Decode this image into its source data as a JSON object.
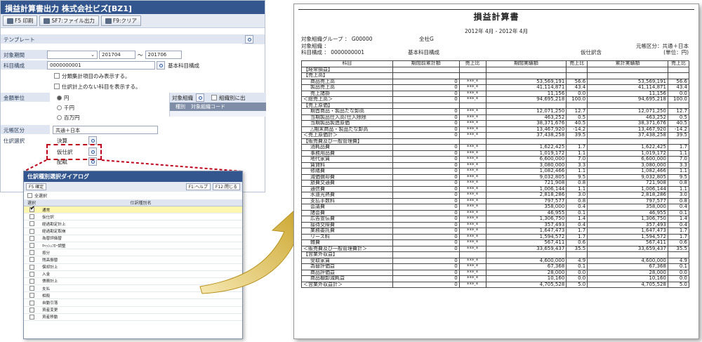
{
  "app": {
    "title": "損益計算書出力 株式会社ビズ[BZ1]",
    "toolbar": [
      {
        "label": "F5 印刷"
      },
      {
        "label": "SF7:ファイル出力"
      },
      {
        "label": "F9:クリア"
      }
    ],
    "template_label": "テンプレート",
    "period_label": "対象期間",
    "period_from": "201704",
    "period_sep": "～",
    "period_to": "201706",
    "account_struct_label": "科目構成",
    "account_struct_code": "0000000001",
    "account_struct_name": "基本科目構成",
    "opt1": "分類集計項目のみ表示する。",
    "opt2": "仕訳計上のない科目を表示する。",
    "unit_label": "金額単位",
    "units": [
      "円",
      "千円",
      "百万円"
    ],
    "target_org_label": "対象組織",
    "org_split_label": "組織別に出",
    "col_kind": "種別",
    "col_orgcode": "対象組織コード",
    "yuan_label": "元帳区分",
    "yuan_value": "共通＋日本",
    "shiwake_label": "仕訳選択",
    "shiwake_items": [
      "決算",
      "仮仕訳",
      "配賦"
    ]
  },
  "dialog": {
    "title": "仕訳種別選択ダイアログ",
    "confirm": "F5 確定",
    "help": "F1:ヘルプ",
    "close": "F12:閉じる",
    "select_all": "全選択",
    "col_select": "選択",
    "col_name": "仕訳種別名",
    "rows": [
      "通常",
      "仮仕訳",
      "経過勘定計上",
      "経過勘定取崩",
      "為替評価替",
      "ｷｬｯｼｭﾌﾛｰ調整",
      "按分",
      "残高振替",
      "償却計上",
      "入金",
      "債務計上",
      "支払",
      "相殺",
      "自動引落",
      "資産変更",
      "資産移動"
    ]
  },
  "report": {
    "title": "損益計算書",
    "period": "2012年 4月 - 2012年 4月",
    "group_label": "対象組織グループ ： G00000",
    "group_name": "全社G",
    "org_label": "対象組織 ：",
    "ledger": "元帳区分：共通＋日本",
    "acct_label": "科目構成 ： 0000000001",
    "acct_name": "基本科目構成",
    "kari": "仮仕訳含",
    "unit": "(単位：円)",
    "headers": [
      "科目",
      "期間前累計額",
      "売上比",
      "期間実績額",
      "売上比",
      "累計実績額",
      "売上比"
    ],
    "rows": [
      [
        "【経常損益】",
        "",
        "",
        "",
        "",
        "",
        ""
      ],
      [
        "【売上高】",
        "",
        "",
        "",
        "",
        "",
        ""
      ],
      [
        "商品売上高",
        "0",
        "***.*",
        "53,569,191",
        "56.6",
        "53,569,191",
        "56.6"
      ],
      [
        "製品売上高",
        "0",
        "***.*",
        "41,114,871",
        "43.4",
        "41,114,871",
        "43.4"
      ],
      [
        "売上諸掛",
        "0",
        "***.*",
        "11,156",
        "0.0",
        "11,156",
        "0.0"
      ],
      [
        "＜総売上高＞",
        "0",
        "***.*",
        "94,695,218",
        "100.0",
        "94,695,218",
        "100.0"
      ],
      [
        "【売上原価】",
        "",
        "",
        "",
        "",
        "",
        ""
      ],
      [
        "期首商品・製品たな卸高",
        "0",
        "***.*",
        "12,071,250",
        "12.7",
        "12,071,250",
        "12.7"
      ],
      [
        "当期製品仕入高(仕入除除",
        "0",
        "***.*",
        "463,252",
        "0.5",
        "463,252",
        "0.5"
      ],
      [
        "当期製品製造原価",
        "0",
        "***.*",
        "38,371,676",
        "40.5",
        "38,371,676",
        "40.5"
      ],
      [
        "△期末商品・製品たな卸高",
        "0",
        "***.*",
        "13,467,920",
        "-14.2",
        "13,467,920",
        "-14.2"
      ],
      [
        "＜売上原価計＞",
        "0",
        "***.*",
        "37,438,258",
        "39.5",
        "37,438,258",
        "39.5"
      ],
      [
        "【販売費及び一般管理費】",
        "",
        "",
        "",
        "",
        "",
        ""
      ],
      [
        "消耗品費",
        "0",
        "***.*",
        "1,622,425",
        "1.7",
        "1,622,425",
        "1.7"
      ],
      [
        "事務用品費",
        "0",
        "***.*",
        "1,019,172",
        "1.1",
        "1,019,172",
        "1.1"
      ],
      [
        "地代家賃",
        "0",
        "***.*",
        "6,600,000",
        "7.0",
        "6,600,000",
        "7.0"
      ],
      [
        "賃貸料",
        "0",
        "***.*",
        "3,080,000",
        "3.3",
        "3,080,000",
        "3.3"
      ],
      [
        "修繕費",
        "0",
        "***.*",
        "1,082,466",
        "1.1",
        "1,082,466",
        "1.1"
      ],
      [
        "減価償却費",
        "0",
        "***.*",
        "9,032,805",
        "9.5",
        "9,032,805",
        "9.5"
      ],
      [
        "旅費交通費",
        "0",
        "***.*",
        "721,908",
        "0.8",
        "721,908",
        "0.8"
      ],
      [
        "通信費",
        "0",
        "***.*",
        "1,006,144",
        "1.1",
        "1,006,144",
        "1.1"
      ],
      [
        "水道光熱費",
        "0",
        "***.*",
        "2,818,286",
        "3.0",
        "2,818,286",
        "3.0"
      ],
      [
        "支払手数料",
        "0",
        "***.*",
        "797,577",
        "0.8",
        "797,577",
        "0.8"
      ],
      [
        "会議費",
        "0",
        "***.*",
        "358,000",
        "0.4",
        "358,000",
        "0.4"
      ],
      [
        "諸会費",
        "0",
        "***.*",
        "46,955",
        "0.1",
        "46,955",
        "0.1"
      ],
      [
        "広告宣伝費",
        "0",
        "***.*",
        "1,306,750",
        "1.4",
        "1,306,750",
        "1.4"
      ],
      [
        "接待交際費",
        "0",
        "***.*",
        "357,493",
        "0.4",
        "357,493",
        "0.4"
      ],
      [
        "業務委託費",
        "0",
        "***.*",
        "1,647,473",
        "1.7",
        "1,647,473",
        "1.7"
      ],
      [
        "リース料",
        "0",
        "***.*",
        "1,594,572",
        "1.7",
        "1,594,572",
        "1.7"
      ],
      [
        "雑費",
        "0",
        "***.*",
        "567,411",
        "0.6",
        "567,411",
        "0.6"
      ],
      [
        "＜販売費及び一般管理費計＞",
        "0",
        "***.*",
        "33,659,437",
        "35.5",
        "33,659,437",
        "35.5"
      ],
      [
        "【営業外収益】",
        "",
        "",
        "",
        "",
        "",
        ""
      ],
      [
        "受取家賃",
        "0",
        "***.*",
        "4,600,000",
        "4.9",
        "4,600,000",
        "4.9"
      ],
      [
        "為替評価益",
        "0",
        "***.*",
        "67,368",
        "0.1",
        "67,368",
        "0.1"
      ],
      [
        "商品評価益",
        "0",
        "***.*",
        "28,000",
        "0.0",
        "28,000",
        "0.0"
      ],
      [
        "商品棚卸減耗益",
        "0",
        "***.*",
        "10,160",
        "0.0",
        "10,160",
        "0.0"
      ],
      [
        "＜営業外収益計＞",
        "0",
        "***.*",
        "4,705,528",
        "5.0",
        "4,705,528",
        "5.0"
      ]
    ]
  }
}
